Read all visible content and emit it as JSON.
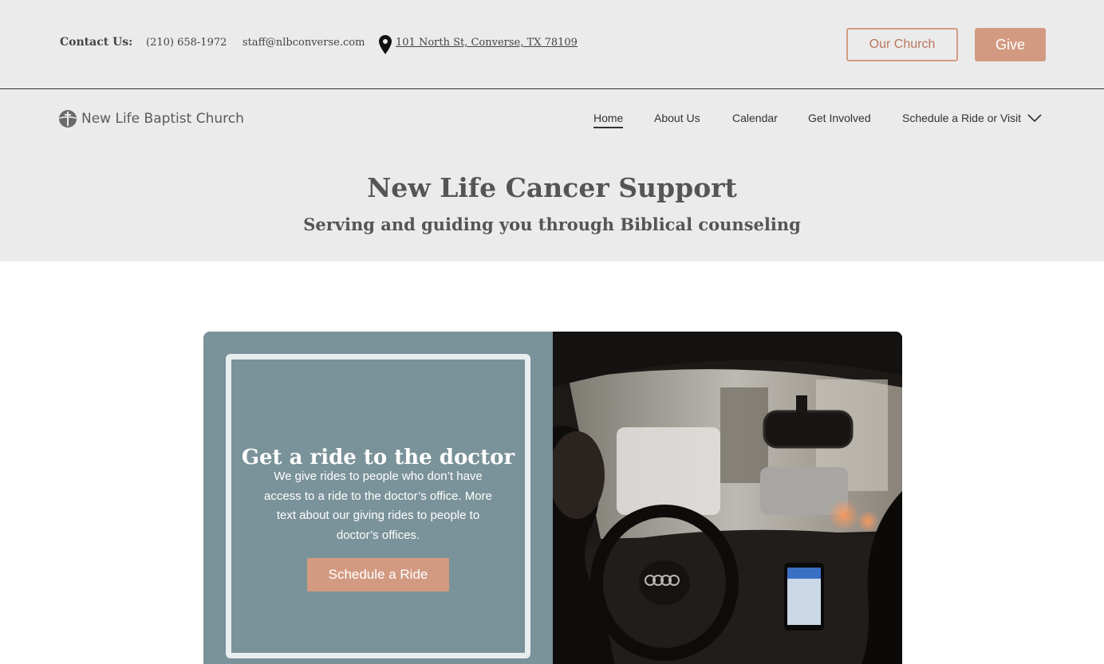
{
  "contact": {
    "label": "Contact Us:",
    "phone": "(210) 658-1972",
    "email": "staff@nlbconverse.com",
    "address": "101 North St, Converse, TX 78109"
  },
  "top_buttons": {
    "our_church": "Our Church",
    "give": "Give"
  },
  "brand": {
    "name": "New Life Baptist Church",
    "icon": "church-logo-icon"
  },
  "nav": {
    "home": "Home",
    "about": "About Us",
    "calendar": "Calendar",
    "involved": "Get Involved",
    "schedule": "Schedule a Ride or Visit",
    "active": "Home"
  },
  "hero": {
    "title": "New Life Cancer Support",
    "subtitle": "Serving and guiding you through Biblical counseling"
  },
  "card": {
    "title": "Get a ride to the doctor",
    "text": "We give rides to people who don’t have access to a ride to the doctor’s office. More text about our giving rides to people to doctor’s offices.",
    "button": "Schedule a Ride",
    "image": "car-interior-photo"
  },
  "colors": {
    "accent": "#d39a82",
    "card_bg": "#7a9299",
    "band_bg": "#ebebeb"
  }
}
